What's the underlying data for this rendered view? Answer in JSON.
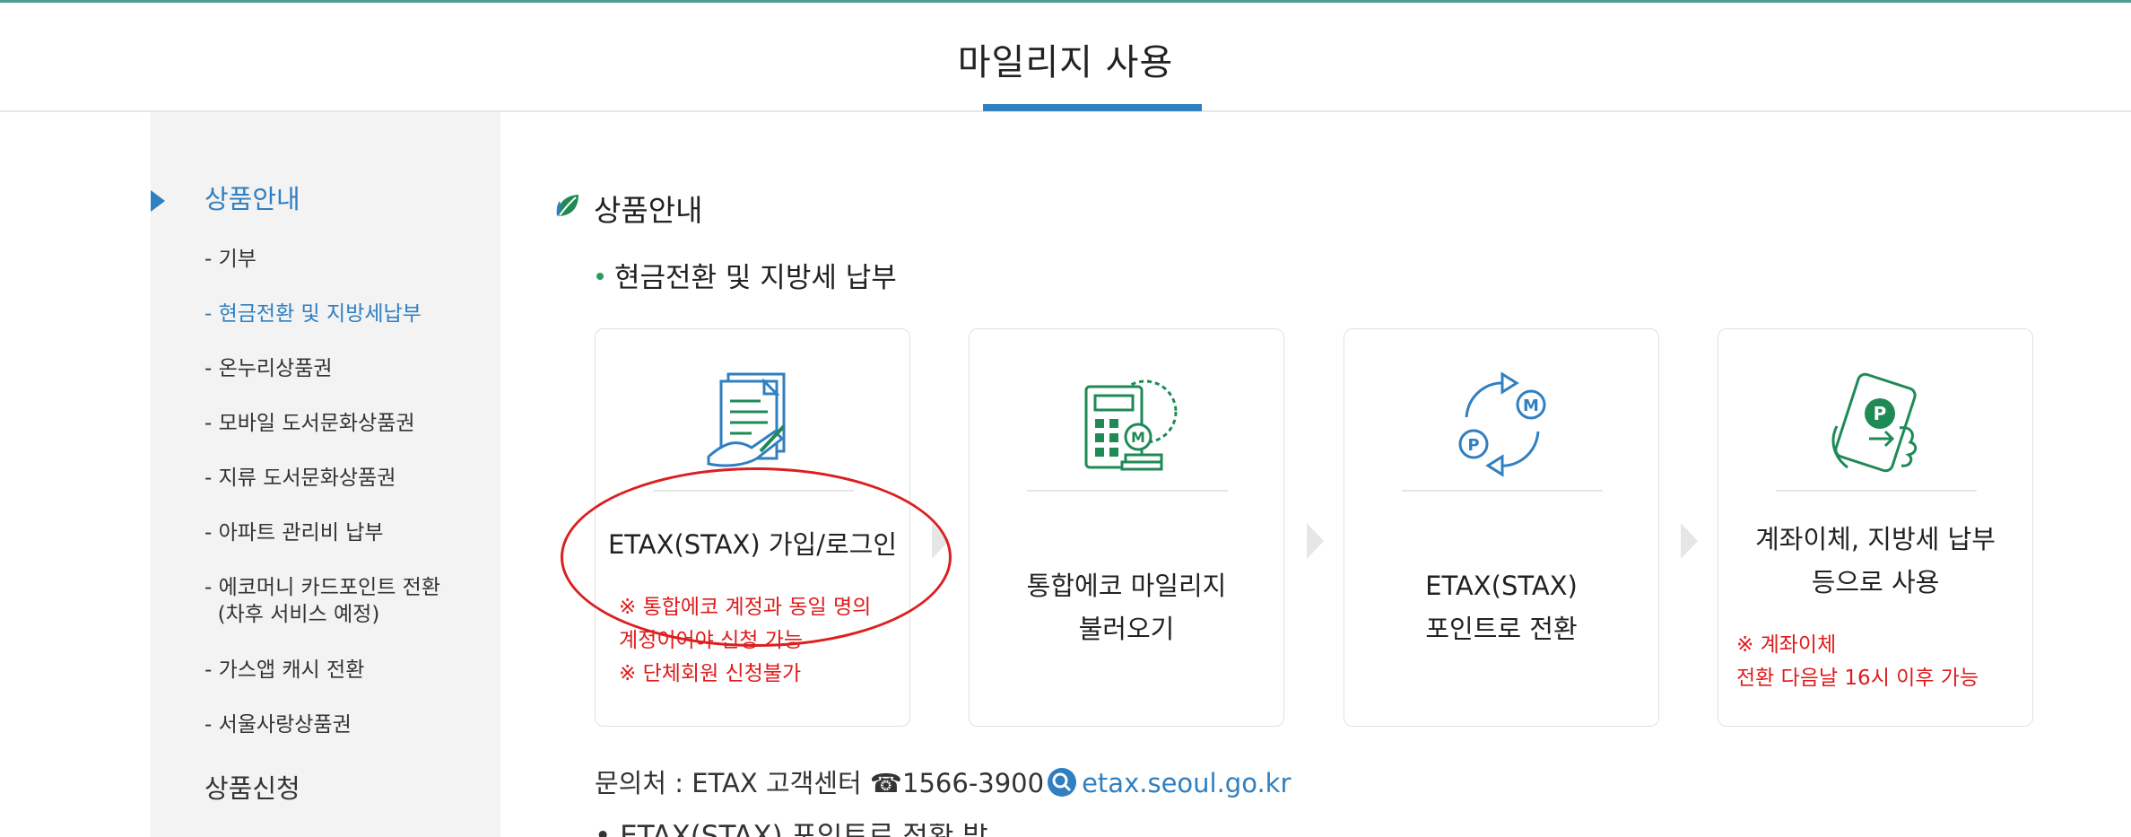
{
  "header": {
    "title": "마일리지 사용"
  },
  "sidebar": {
    "main_label": "상품안내",
    "items": [
      {
        "label": "- 기부"
      },
      {
        "label": "- 현금전환 및 지방세납부"
      },
      {
        "label": "- 온누리상품권"
      },
      {
        "label": "- 모바일 도서문화상품권"
      },
      {
        "label": "- 지류 도서문화상품권"
      },
      {
        "label": "- 아파트 관리비 납부"
      },
      {
        "label": "- 에코머니 카드포인트 전환\n  (차후 서비스 예정)"
      },
      {
        "label": "- 가스앱 캐시 전환"
      },
      {
        "label": "- 서울사랑상품권"
      }
    ],
    "bottom_label": "상품신청"
  },
  "main": {
    "section_title": "상품안내",
    "subsection_title": "현금전환 및 지방세 납부",
    "cards": [
      {
        "title": "ETAX(STAX) 가입/로그인",
        "note": "※ 통합에코 계정과 동일 명의\n    계정이어야 신청 가능\n※ 단체회원 신청불가",
        "icon": "document-sign-icon"
      },
      {
        "title": "통합에코 마일리지\n불러오기",
        "note": "",
        "icon": "calculator-mileage-icon"
      },
      {
        "title": "ETAX(STAX)\n포인트로 전환",
        "note": "",
        "icon": "point-exchange-icon"
      },
      {
        "title": "계좌이체, 지방세 납부\n등으로 사용",
        "note": "※ 계좌이체\n    전환 다음날 16시 이후 가능",
        "icon": "phone-point-icon"
      }
    ],
    "contact_label": "문의처 : ETAX 고객센터 ☎1566-3900",
    "contact_link": "etax.seoul.go.kr",
    "next_section_partial": "• ETAX(STAX) 포인트로 전환 방법"
  },
  "colors": {
    "accent": "#2f7fc1",
    "icon_green": "#1f8a55",
    "icon_blue": "#2f7fc1",
    "note_red": "#e01b1b",
    "highlight_red": "#dc1f1f"
  }
}
